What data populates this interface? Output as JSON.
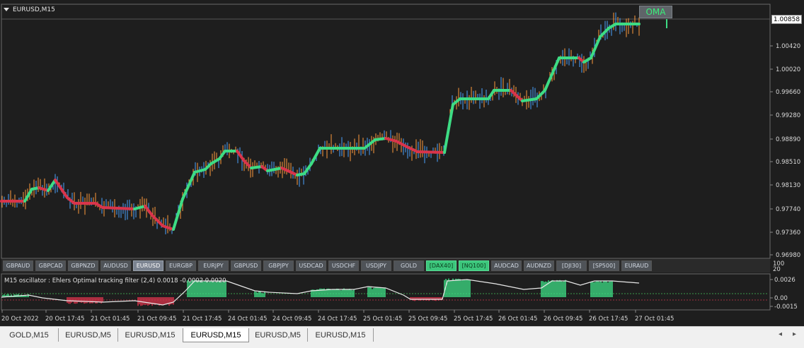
{
  "chart": {
    "title": "EURUSD,M15",
    "oma_label": "OMA",
    "current_price": "1.00858",
    "price_axis": [
      "1.00858",
      "1.00420",
      "1.00020",
      "0.99660",
      "0.99280",
      "0.98890",
      "0.98510",
      "0.98130",
      "0.97740",
      "0.97360",
      "0.96980"
    ],
    "colors": {
      "uptrend": "#3ddc84",
      "downtrend": "#d9344b",
      "neutral": "#e8e8e8",
      "background": "#1e1e1e"
    }
  },
  "symbol_bar": [
    {
      "label": "GBPAUD",
      "state": "normal"
    },
    {
      "label": "GBPCAD",
      "state": "normal"
    },
    {
      "label": "GBPNZD",
      "state": "normal"
    },
    {
      "label": "AUDUSD",
      "state": "normal"
    },
    {
      "label": "EURUSD",
      "state": "active"
    },
    {
      "label": "EURGBP",
      "state": "normal"
    },
    {
      "label": "EURJPY",
      "state": "normal"
    },
    {
      "label": "GBPUSD",
      "state": "normal"
    },
    {
      "label": "GBPJPY",
      "state": "normal"
    },
    {
      "label": "USDCAD",
      "state": "normal"
    },
    {
      "label": "USDCHF",
      "state": "normal"
    },
    {
      "label": "USDJPY",
      "state": "normal"
    },
    {
      "label": "GOLD",
      "state": "normal"
    },
    {
      "label": "[DAX40]",
      "state": "green"
    },
    {
      "label": "[NQ100]",
      "state": "green"
    },
    {
      "label": "AUDCAD",
      "state": "normal"
    },
    {
      "label": "AUDNZD",
      "state": "normal"
    },
    {
      "label": "[DJI30]",
      "state": "normal"
    },
    {
      "label": "[SP500]",
      "state": "normal"
    },
    {
      "label": "EURAUD",
      "state": "normal"
    }
  ],
  "oscillator": {
    "label": "M15  oscillator : Ehlers Optimal tracking filter (2,4)  0.0018 -0.0002 0.0020",
    "axis_top": [
      "100",
      "20"
    ],
    "axis": [
      "0.0026",
      "0.00",
      "-0.0015"
    ]
  },
  "time_axis": [
    "20 Oct 2022",
    "20 Oct 17:45",
    "21 Oct 01:45",
    "21 Oct 09:45",
    "21 Oct 17:45",
    "24 Oct 01:45",
    "24 Oct 09:45",
    "24 Oct 17:45",
    "25 Oct 01:45",
    "25 Oct 09:45",
    "25 Oct 17:45",
    "26 Oct 01:45",
    "26 Oct 09:45",
    "26 Oct 17:45",
    "27 Oct 01:45"
  ],
  "tabs": [
    {
      "label": "GOLD,M15",
      "active": false
    },
    {
      "label": "EURUSD,M5",
      "active": false
    },
    {
      "label": "EURUSD,M15",
      "active": false
    },
    {
      "label": "EURUSD,M15",
      "active": true
    },
    {
      "label": "EURUSD,M5",
      "active": false
    },
    {
      "label": "EURUSD,M15",
      "active": false
    }
  ],
  "tab_arrows": {
    "left": "◂",
    "right": "▸"
  }
}
